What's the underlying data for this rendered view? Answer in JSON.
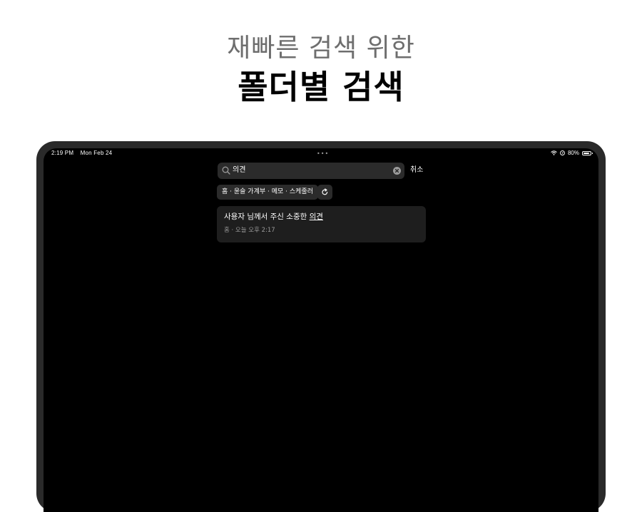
{
  "promo": {
    "headline": "재빠른 검색 위한",
    "title": "폴더별 검색"
  },
  "status_bar": {
    "time": "2:19 PM",
    "date": "Mon Feb 24",
    "battery_pct": "80%",
    "icons": [
      "wifi-icon",
      "location-icon",
      "battery-icon"
    ]
  },
  "search": {
    "query": "의견",
    "cancel_label": "취소",
    "icons": [
      "search-icon",
      "clear-icon"
    ]
  },
  "filter": {
    "path_label": "홈 · 윤슬 가계부 · 메모 · 스케줄러",
    "refresh_icon": "refresh-icon"
  },
  "results": [
    {
      "title_prefix": "사용자 님께서 주신 소중한 ",
      "title_match": "의견",
      "meta": "홈 · 오늘 오후 2:17"
    }
  ],
  "colors": {
    "screen_bg": "#000000",
    "field_bg": "#2b2b2b",
    "card_bg": "#1e1e1e",
    "secondary_text": "#9a9a9a"
  }
}
